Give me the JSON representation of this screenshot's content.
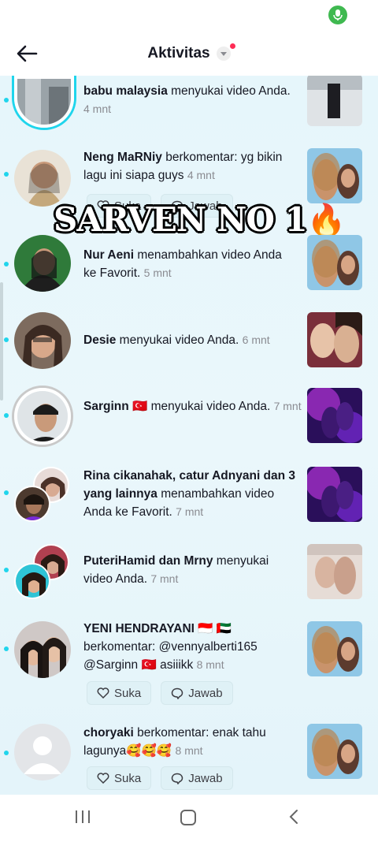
{
  "header": {
    "title": "Aktivitas"
  },
  "overlay": {
    "text": "SARVEN NO 1",
    "emoji": "🔥"
  },
  "items": [
    {
      "user": "babu malaysia",
      "action": " menyukai video Anda.",
      "time": "4 mnt"
    },
    {
      "user": "Neng MaRNiy",
      "action": " berkomentar: yg bikin lagu ini siapa guys",
      "time": "4 mnt",
      "like": "Suka",
      "reply": "Jawab"
    },
    {
      "user": "Nur Aeni",
      "action": " menambahkan video Anda ke Favorit.",
      "time": "5 mnt"
    },
    {
      "user": "Desie",
      "action": " menyukai video Anda.",
      "time": "6 mnt"
    },
    {
      "user": "Sarginn 🇹🇷",
      "action": " menyukai video Anda.",
      "time": "7 mnt"
    },
    {
      "user": "Rina cikanahak, catur Adnyani dan 3 yang lainnya",
      "action": " menambahkan video Anda ke Favorit.",
      "time": "7 mnt"
    },
    {
      "user": "PuteriHamid dan Mrny",
      "action": " menyukai video Anda.",
      "time": "7 mnt"
    },
    {
      "user": "YENI HENDRAYANI 🇮🇩 🇦🇪",
      "action": " berkomentar: @vennyalberti165 @Sarginn 🇹🇷 asiiikk",
      "time": "8 mnt",
      "like": "Suka",
      "reply": "Jawab"
    },
    {
      "user": "choryaki",
      "action": " berkomentar: enak tahu lagunya🥰🥰🥰",
      "time": "8 mnt",
      "like": "Suka",
      "reply": "Jawab"
    }
  ],
  "icons": {
    "back": "arrow-left-icon",
    "mic": "mic-icon",
    "heart": "heart-icon",
    "comment": "comment-icon",
    "recents": "recents-icon",
    "home": "home-icon",
    "back_nav": "chevron-left-icon"
  },
  "colors": {
    "accent": "#20d5ec",
    "badge": "#fe2c55",
    "mic": "#3fb950",
    "feed_bg": "#e6f6fb"
  }
}
